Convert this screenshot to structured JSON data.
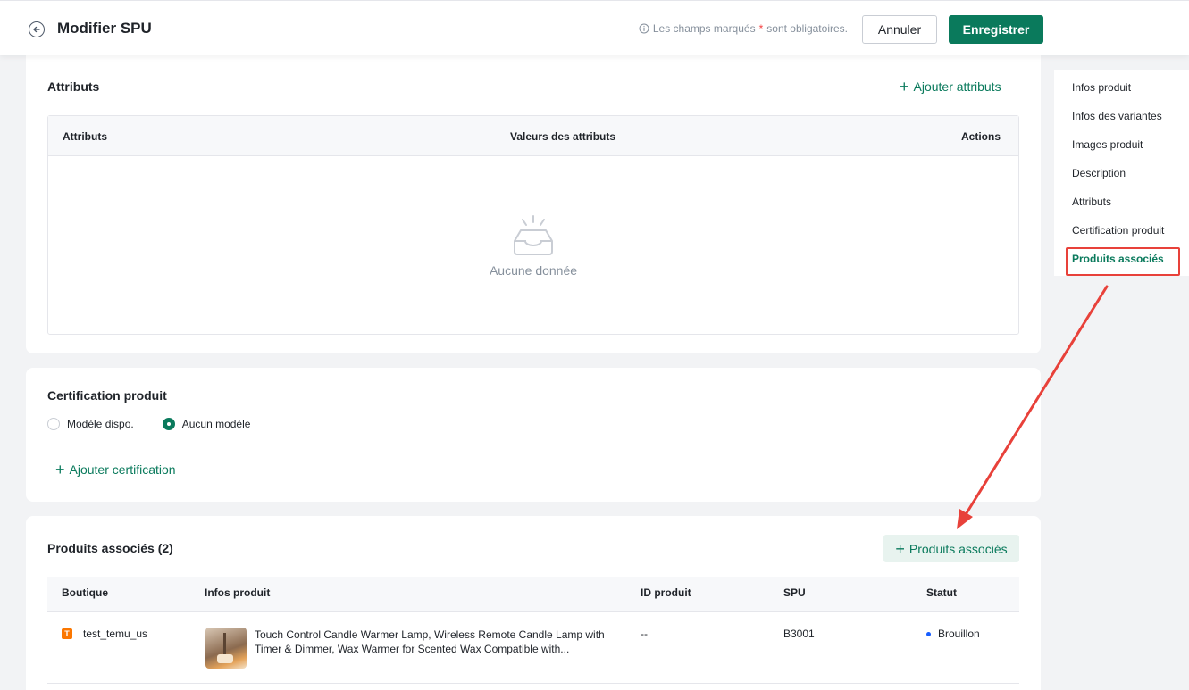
{
  "header": {
    "title": "Modifier SPU",
    "required_prefix": "Les champs marqués",
    "required_star": "*",
    "required_suffix": "sont obligatoires.",
    "cancel_label": "Annuler",
    "save_label": "Enregistrer"
  },
  "attributes": {
    "title": "Attributs",
    "add_label": "Ajouter attributs",
    "columns": [
      "Attributs",
      "Valeurs des attributs",
      "Actions"
    ],
    "empty_text": "Aucune donnée"
  },
  "certification": {
    "title": "Certification produit",
    "options": [
      {
        "label": "Modèle dispo.",
        "selected": false
      },
      {
        "label": "Aucun modèle",
        "selected": true
      }
    ],
    "add_label": "Ajouter certification"
  },
  "associated": {
    "title": "Produits associés (2)",
    "add_label": "Produits associés",
    "columns": [
      "Boutique",
      "Infos produit",
      "ID produit",
      "SPU",
      "Statut"
    ],
    "rows": [
      {
        "shop_badge": "T",
        "shop": "test_temu_us",
        "product_title": "Touch Control Candle Warmer Lamp, Wireless Remote Candle Lamp with Timer & Dimmer, Wax Warmer for Scented Wax Compatible with...",
        "product_id": "--",
        "spu": "B3001",
        "status": "Brouillon",
        "status_color": "#165dff"
      }
    ]
  },
  "anchor_nav": {
    "items": [
      "Infos produit",
      "Infos des variantes",
      "Images produit",
      "Description",
      "Attributs",
      "Certification produit",
      "Produits associés"
    ],
    "active_index": 6
  },
  "colors": {
    "primary": "#0a7a5c",
    "annotation": "#e8413a",
    "badge": "#fb7701"
  }
}
